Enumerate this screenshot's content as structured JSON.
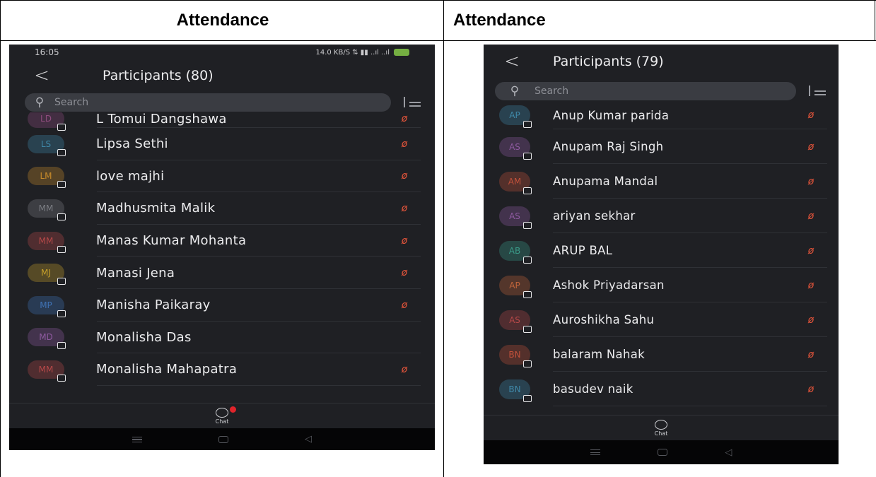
{
  "doc": {
    "left_header": "Attendance",
    "right_header": "Attendance"
  },
  "left_phone": {
    "status": {
      "time": "16:05",
      "icons": "14.0 KB/S ⇅ ▮▮ ..ıl ..ıl"
    },
    "title": "Participants (80)",
    "search_placeholder": "Search",
    "chat_label": "Chat",
    "participants": [
      {
        "initials": "LD",
        "name": "L Tomui Dangshawa",
        "muted": true,
        "color": "#8e4c7d"
      },
      {
        "initials": "LS",
        "name": "Lipsa Sethi",
        "muted": true,
        "color": "#3f88a8"
      },
      {
        "initials": "LM",
        "name": "love majhi",
        "muted": true,
        "color": "#c78a2a"
      },
      {
        "initials": "MM",
        "name": "Madhusmita Malik",
        "muted": true,
        "color": "#7a7c82"
      },
      {
        "initials": "MM",
        "name": "Manas Kumar Mohanta",
        "muted": true,
        "color": "#b54848"
      },
      {
        "initials": "MJ",
        "name": "Manasi Jena",
        "muted": true,
        "color": "#c7a02a"
      },
      {
        "initials": "MP",
        "name": "Manisha Paikaray",
        "muted": true,
        "color": "#3f72b4"
      },
      {
        "initials": "MD",
        "name": "Monalisha Das",
        "muted": false,
        "color": "#8e5aa0"
      },
      {
        "initials": "MM",
        "name": "Monalisha Mahapatra",
        "muted": true,
        "color": "#b54848"
      }
    ]
  },
  "right_phone": {
    "title": "Participants (79)",
    "search_placeholder": "Search",
    "chat_label": "Chat",
    "participants": [
      {
        "initials": "AP",
        "name": "Anup Kumar parida",
        "muted": true,
        "color": "#3f88a8"
      },
      {
        "initials": "AS",
        "name": "Anupam Raj Singh",
        "muted": true,
        "color": "#8e5aa0"
      },
      {
        "initials": "AM",
        "name": "Anupama Mandal",
        "muted": true,
        "color": "#c0503a"
      },
      {
        "initials": "AS",
        "name": "ariyan sekhar",
        "muted": true,
        "color": "#8e5aa0"
      },
      {
        "initials": "AB",
        "name": "ARUP BAL",
        "muted": true,
        "color": "#3a9a88"
      },
      {
        "initials": "AP",
        "name": "Ashok Priyadarsan",
        "muted": true,
        "color": "#c0643a"
      },
      {
        "initials": "AS",
        "name": "Auroshikha Sahu",
        "muted": true,
        "color": "#b54848"
      },
      {
        "initials": "BN",
        "name": "balaram Nahak",
        "muted": true,
        "color": "#c0503a"
      },
      {
        "initials": "BN",
        "name": "basudev naik",
        "muted": true,
        "color": "#3f88a8"
      }
    ]
  },
  "icons": {
    "back": "chevron-left-icon",
    "search": "search-icon",
    "sort": "sort-list-icon",
    "mic": "muted-mic-icon",
    "chat": "chat-bubble-icon"
  }
}
